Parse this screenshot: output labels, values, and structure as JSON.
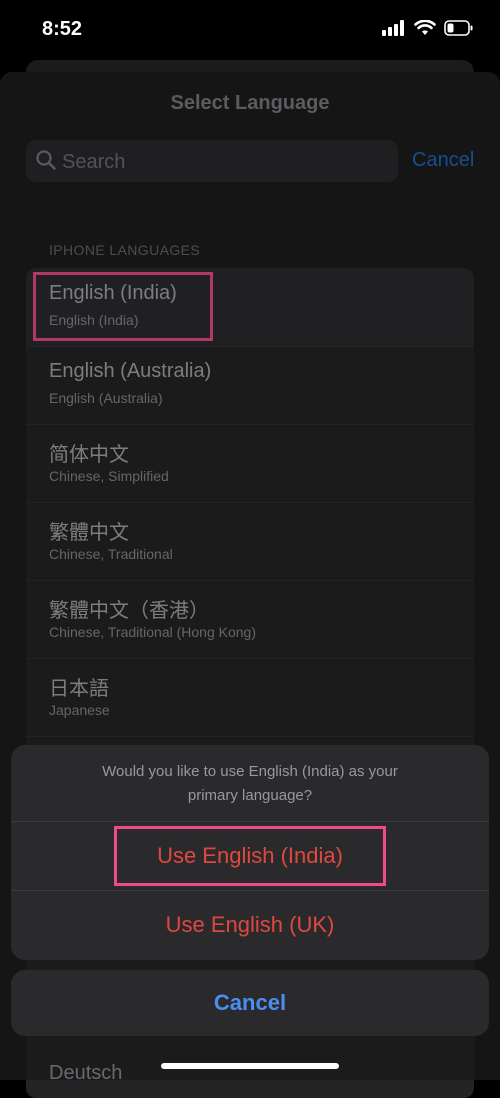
{
  "status_bar": {
    "time": "8:52",
    "icons": [
      "cellular-signal-icon",
      "wifi-icon",
      "battery-icon"
    ]
  },
  "sheet": {
    "title": "Select Language"
  },
  "search": {
    "placeholder": "Search",
    "cancel_label": "Cancel"
  },
  "section_header": "IPHONE LANGUAGES",
  "languages": [
    {
      "native": "English (India)",
      "english": "English (India)"
    },
    {
      "native": "English (Australia)",
      "english": "English (Australia)"
    },
    {
      "native": "简体中文",
      "english": "Chinese, Simplified"
    },
    {
      "native": "繁體中文",
      "english": "Chinese, Traditional"
    },
    {
      "native": "繁體中文（香港）",
      "english": "Chinese, Traditional (Hong Kong)"
    },
    {
      "native": "日本語",
      "english": "Japanese"
    }
  ],
  "peek_language": "Deutsch",
  "action_sheet": {
    "message_line1": "Would you like to use English (India) as your",
    "message_line2": "primary language?",
    "primary_action": "Use English (India)",
    "secondary_action": "Use English (UK)",
    "cancel_label": "Cancel"
  },
  "colors": {
    "accent_blue": "#4b8ef0",
    "destructive_red": "#e0483f",
    "highlight_pink": "#ee4b88"
  }
}
